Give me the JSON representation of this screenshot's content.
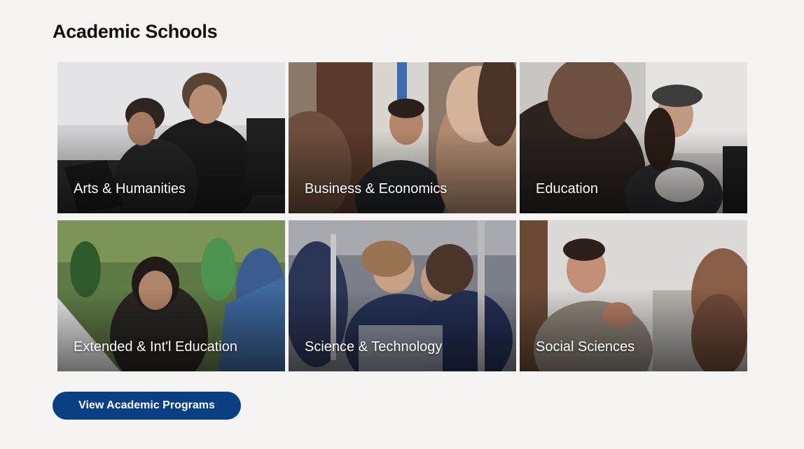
{
  "section": {
    "title": "Academic Schools"
  },
  "schools": [
    {
      "label": "Arts & Humanities",
      "photo": "students-with-music-stand"
    },
    {
      "label": "Business & Economics",
      "photo": "smiling-student-in-classroom"
    },
    {
      "label": "Education",
      "photo": "smiling-student-in-cap"
    },
    {
      "label": "Extended & Int'l Education",
      "photo": "student-outdoor-fieldwork"
    },
    {
      "label": "Science & Technology",
      "photo": "students-in-lab-goggles"
    },
    {
      "label": "Social Sciences",
      "photo": "smiling-student-seated"
    }
  ],
  "cta": {
    "label": "View Academic Programs"
  },
  "colors": {
    "background": "#f5f4f2",
    "button": "#0b3f84",
    "label_text": "#ffffff"
  }
}
